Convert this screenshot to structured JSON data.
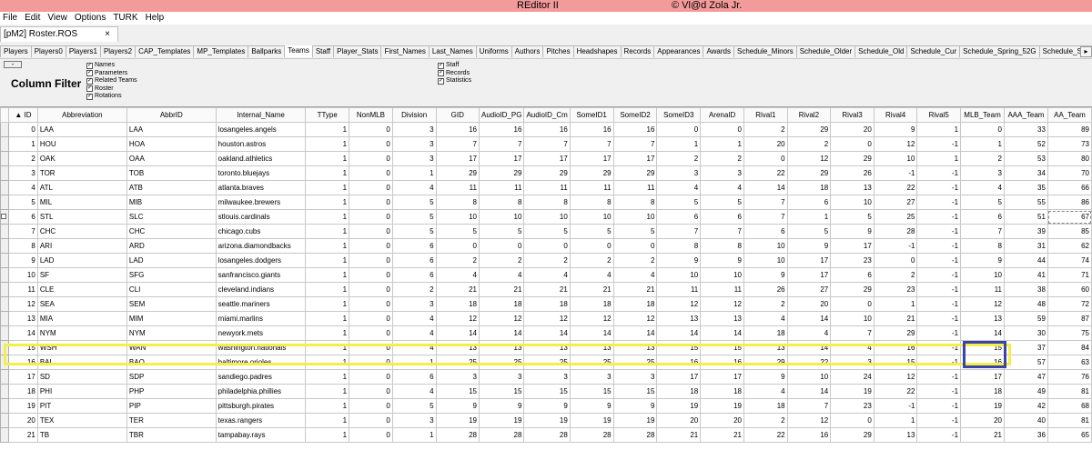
{
  "window": {
    "title": "REditor II",
    "credit": "© Vl@d Zola Jr."
  },
  "menu": [
    "File",
    "Edit",
    "View",
    "Options",
    "TURK",
    "Help"
  ],
  "document_tab": {
    "label": "[pM2] Roster.ROS",
    "close": "×"
  },
  "tabs": [
    "Players",
    "Players0",
    "Players1",
    "Players2",
    "CAP_Templates",
    "MP_Templates",
    "Ballparks",
    "Teams",
    "Staff",
    "Player_Stats",
    "First_Names",
    "Last_Names",
    "Uniforms",
    "Authors",
    "Pitches",
    "Headshapes",
    "Records",
    "Appearances",
    "Awards",
    "Schedule_Minors",
    "Schedule_Older",
    "Schedule_Old",
    "Schedule_Cur",
    "Schedule_Spring_52G",
    "Schedule_Spring_104G",
    "Schedule_Spring_162G",
    "Sc"
  ],
  "active_tab": "Teams",
  "tab_scroll": "▸",
  "filter": {
    "collapse": "-",
    "title": "Column Filter",
    "group1": [
      "Names",
      "Parameters",
      "Related Teams",
      "Roster",
      "Rotations"
    ],
    "group2": [
      "Staff",
      "Records",
      "Statistics"
    ]
  },
  "columns": [
    "▲ ID",
    "Abbreviation",
    "AbbrID",
    "Internal_Name",
    "TType",
    "NonMLB",
    "Division",
    "GID",
    "AudioID_PG",
    "AudioID_Cm",
    "SomeID1",
    "SomeID2",
    "SomeID3",
    "ArenaID",
    "Rival1",
    "Rival2",
    "Rival3",
    "Rival4",
    "Rival5",
    "MLB_Team",
    "AAA_Team",
    "AA_Team"
  ],
  "rows": [
    [
      "0",
      "LAA",
      "LAA",
      "losangeles.angels",
      "1",
      "0",
      "3",
      "16",
      "16",
      "16",
      "16",
      "16",
      "0",
      "0",
      "2",
      "29",
      "20",
      "9",
      "1",
      "0",
      "33",
      "89"
    ],
    [
      "1",
      "HOU",
      "HOA",
      "houston.astros",
      "1",
      "0",
      "3",
      "7",
      "7",
      "7",
      "7",
      "7",
      "1",
      "1",
      "20",
      "2",
      "0",
      "12",
      "-1",
      "1",
      "52",
      "73"
    ],
    [
      "2",
      "OAK",
      "OAA",
      "oakland.athletics",
      "1",
      "0",
      "3",
      "17",
      "17",
      "17",
      "17",
      "17",
      "2",
      "2",
      "0",
      "12",
      "29",
      "10",
      "1",
      "2",
      "53",
      "80"
    ],
    [
      "3",
      "TOR",
      "TOB",
      "toronto.bluejays",
      "1",
      "0",
      "1",
      "29",
      "29",
      "29",
      "29",
      "29",
      "3",
      "3",
      "22",
      "29",
      "26",
      "-1",
      "-1",
      "3",
      "34",
      "70"
    ],
    [
      "4",
      "ATL",
      "ATB",
      "atlanta.braves",
      "1",
      "0",
      "4",
      "11",
      "11",
      "11",
      "11",
      "11",
      "4",
      "4",
      "14",
      "18",
      "13",
      "22",
      "-1",
      "4",
      "35",
      "66"
    ],
    [
      "5",
      "MIL",
      "MIB",
      "milwaukee.brewers",
      "1",
      "0",
      "5",
      "8",
      "8",
      "8",
      "8",
      "8",
      "5",
      "5",
      "7",
      "6",
      "10",
      "27",
      "-1",
      "5",
      "55",
      "86"
    ],
    [
      "6",
      "STL",
      "SLC",
      "stlouis.cardinals",
      "1",
      "0",
      "5",
      "10",
      "10",
      "10",
      "10",
      "10",
      "6",
      "6",
      "7",
      "1",
      "5",
      "25",
      "-1",
      "6",
      "51",
      "67"
    ],
    [
      "7",
      "CHC",
      "CHC",
      "chicago.cubs",
      "1",
      "0",
      "5",
      "5",
      "5",
      "5",
      "5",
      "5",
      "7",
      "7",
      "6",
      "5",
      "9",
      "28",
      "-1",
      "7",
      "39",
      "85"
    ],
    [
      "8",
      "ARI",
      "ARD",
      "arizona.diamondbacks",
      "1",
      "0",
      "6",
      "0",
      "0",
      "0",
      "0",
      "0",
      "8",
      "8",
      "10",
      "9",
      "17",
      "-1",
      "-1",
      "8",
      "31",
      "62"
    ],
    [
      "9",
      "LAD",
      "LAD",
      "losangeles.dodgers",
      "1",
      "0",
      "6",
      "2",
      "2",
      "2",
      "2",
      "2",
      "9",
      "9",
      "10",
      "17",
      "23",
      "0",
      "-1",
      "9",
      "44",
      "74"
    ],
    [
      "10",
      "SF",
      "SFG",
      "sanfrancisco.giants",
      "1",
      "0",
      "6",
      "4",
      "4",
      "4",
      "4",
      "4",
      "10",
      "10",
      "9",
      "17",
      "6",
      "2",
      "-1",
      "10",
      "41",
      "71"
    ],
    [
      "11",
      "CLE",
      "CLI",
      "cleveland.indians",
      "1",
      "0",
      "2",
      "21",
      "21",
      "21",
      "21",
      "21",
      "11",
      "11",
      "26",
      "27",
      "29",
      "23",
      "-1",
      "11",
      "38",
      "60"
    ],
    [
      "12",
      "SEA",
      "SEM",
      "seattle.mariners",
      "1",
      "0",
      "3",
      "18",
      "18",
      "18",
      "18",
      "18",
      "12",
      "12",
      "2",
      "20",
      "0",
      "1",
      "-1",
      "12",
      "48",
      "72"
    ],
    [
      "13",
      "MIA",
      "MIM",
      "miami.marlins",
      "1",
      "0",
      "4",
      "12",
      "12",
      "12",
      "12",
      "12",
      "13",
      "13",
      "4",
      "14",
      "10",
      "21",
      "-1",
      "13",
      "59",
      "87"
    ],
    [
      "14",
      "NYM",
      "NYM",
      "newyork.mets",
      "1",
      "0",
      "4",
      "14",
      "14",
      "14",
      "14",
      "14",
      "14",
      "14",
      "18",
      "4",
      "7",
      "29",
      "-1",
      "14",
      "30",
      "75"
    ],
    [
      "15",
      "WSH",
      "WAN",
      "washington.nationals",
      "1",
      "0",
      "4",
      "13",
      "13",
      "13",
      "13",
      "13",
      "15",
      "15",
      "13",
      "14",
      "4",
      "16",
      "-1",
      "15",
      "37",
      "84"
    ],
    [
      "16",
      "BAL",
      "BAO",
      "baltimore.orioles",
      "1",
      "0",
      "1",
      "25",
      "25",
      "25",
      "25",
      "25",
      "16",
      "16",
      "29",
      "22",
      "3",
      "15",
      "-1",
      "16",
      "57",
      "63"
    ],
    [
      "17",
      "SD",
      "SDP",
      "sandiego.padres",
      "1",
      "0",
      "6",
      "3",
      "3",
      "3",
      "3",
      "3",
      "17",
      "17",
      "9",
      "10",
      "24",
      "12",
      "-1",
      "17",
      "47",
      "76"
    ],
    [
      "18",
      "PHI",
      "PHP",
      "philadelphia.phillies",
      "1",
      "0",
      "4",
      "15",
      "15",
      "15",
      "15",
      "15",
      "18",
      "18",
      "4",
      "14",
      "19",
      "22",
      "-1",
      "18",
      "49",
      "81"
    ],
    [
      "19",
      "PIT",
      "PIP",
      "pittsburgh.pirates",
      "1",
      "0",
      "5",
      "9",
      "9",
      "9",
      "9",
      "9",
      "19",
      "19",
      "18",
      "7",
      "23",
      "-1",
      "-1",
      "19",
      "42",
      "68"
    ],
    [
      "20",
      "TEX",
      "TER",
      "texas.rangers",
      "1",
      "0",
      "3",
      "19",
      "19",
      "19",
      "19",
      "19",
      "20",
      "20",
      "2",
      "12",
      "0",
      "1",
      "-1",
      "20",
      "40",
      "81"
    ],
    [
      "21",
      "TB",
      "TBR",
      "tampabay.rays",
      "1",
      "0",
      "1",
      "28",
      "28",
      "28",
      "28",
      "28",
      "21",
      "21",
      "22",
      "16",
      "29",
      "13",
      "-1",
      "21",
      "36",
      "65"
    ]
  ]
}
